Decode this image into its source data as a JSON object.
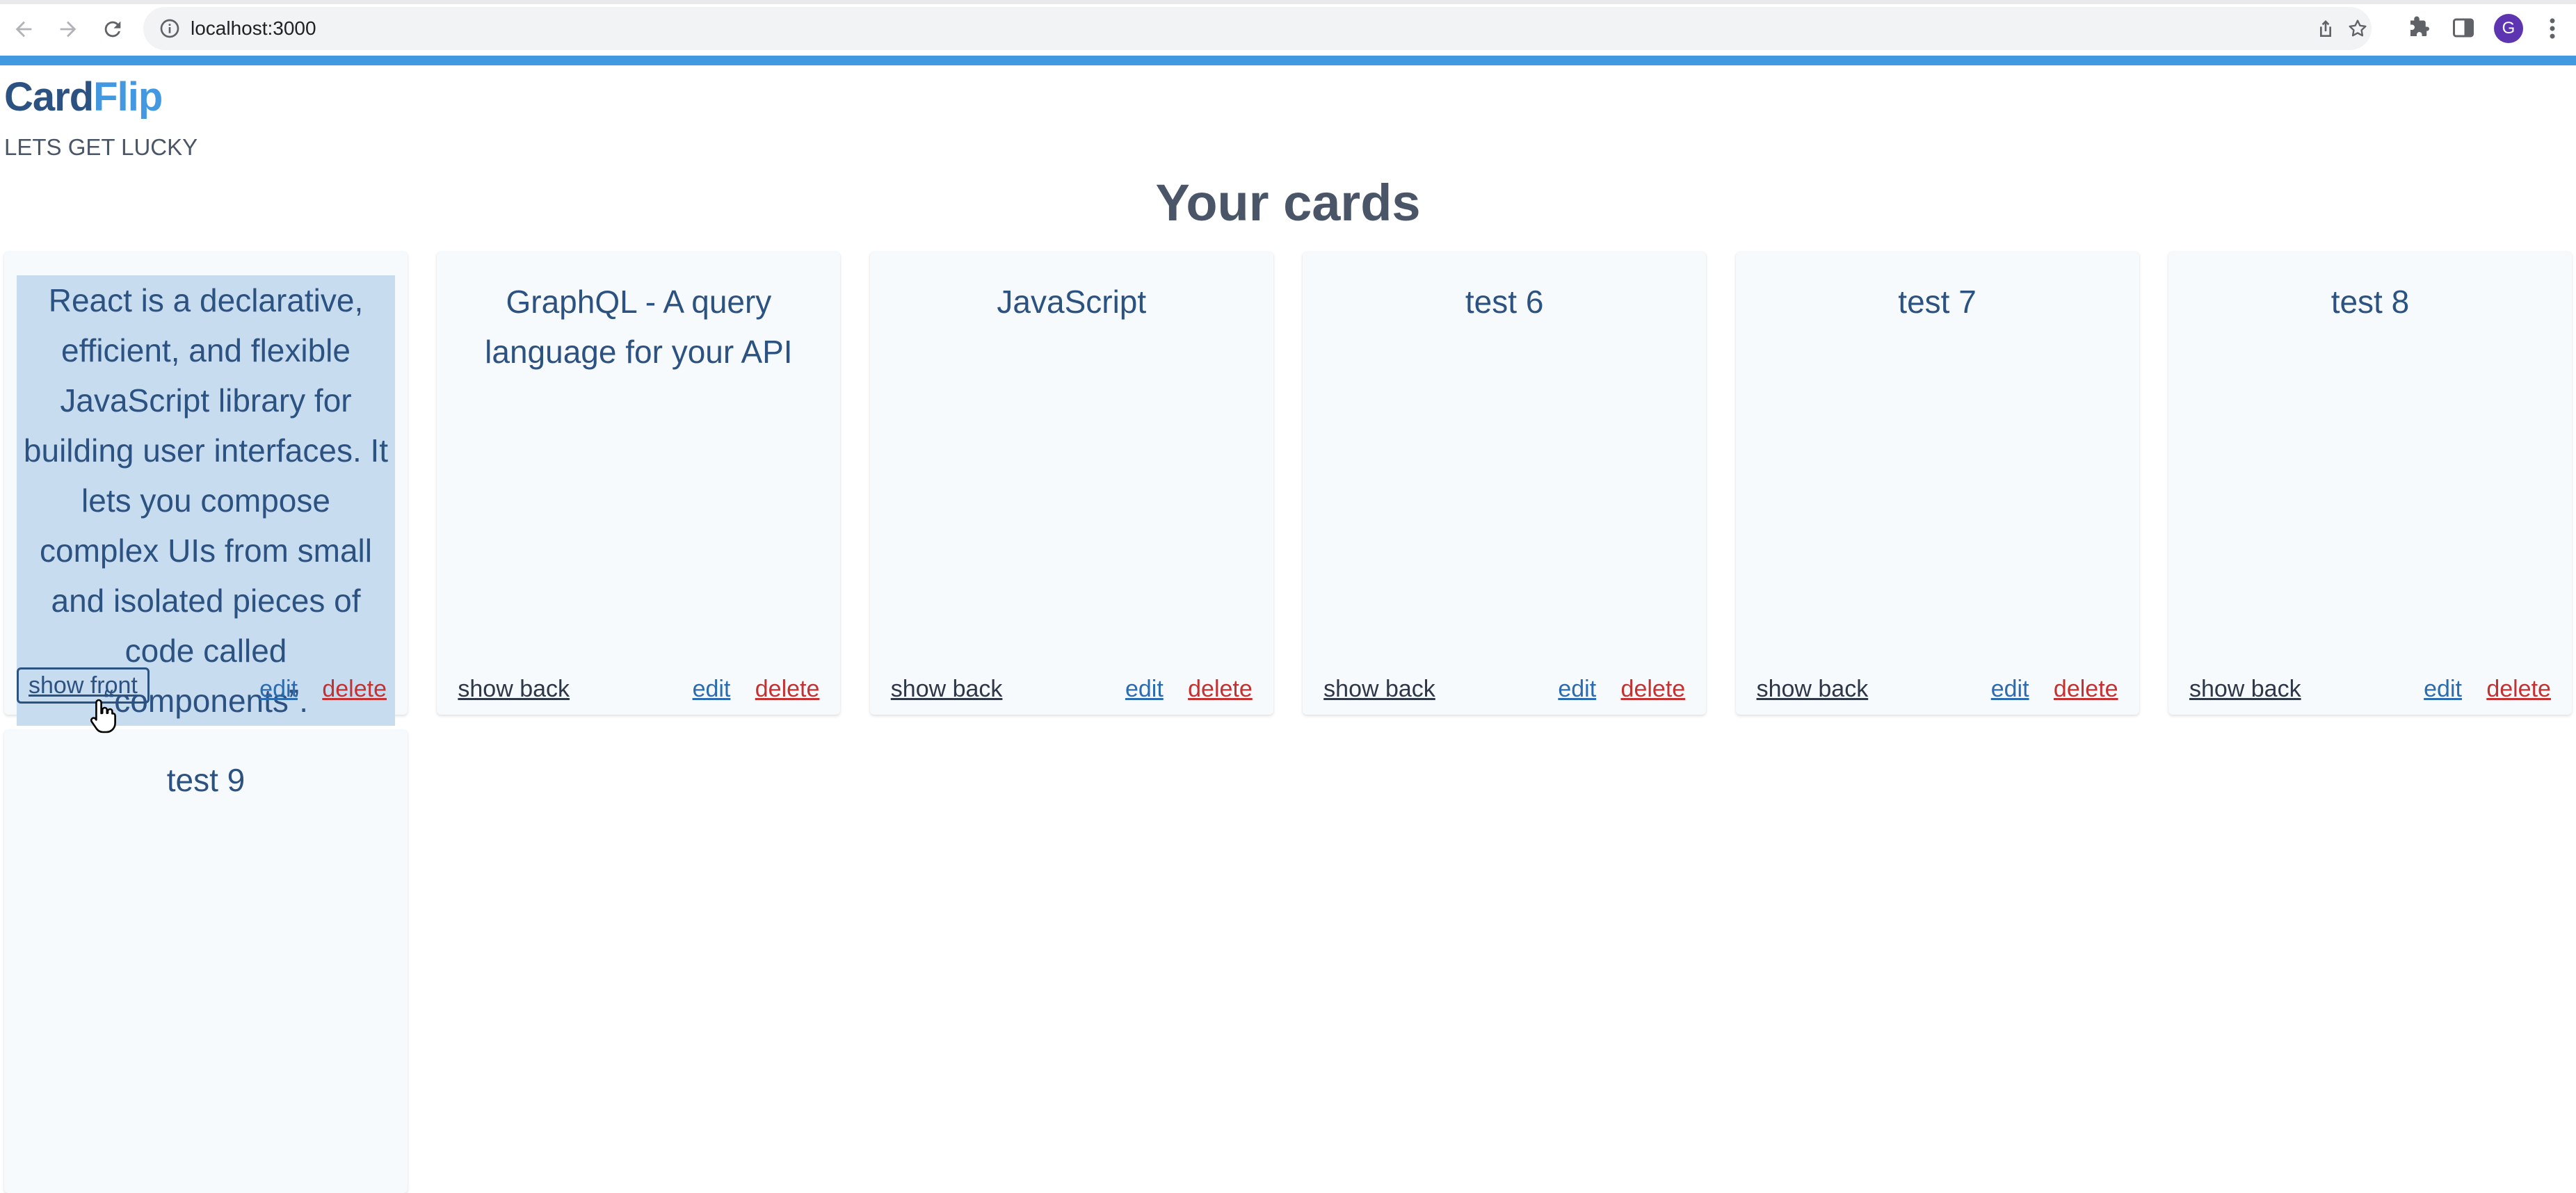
{
  "browser": {
    "url": "localhost:3000",
    "avatar_letter": "G"
  },
  "colors": {
    "accent": "#4299e1",
    "brand_dark": "#2c5282",
    "delete": "#c53030",
    "edit": "#2b6cb0",
    "flipped_bg": "#c8dcf0"
  },
  "header": {
    "brand_part1": "Card",
    "brand_part2": "Flip",
    "tagline": "LETS GET LUCKY"
  },
  "main": {
    "title": "Your cards",
    "cards": [
      {
        "text": "React is a declarative, efficient, and flexible JavaScript library for building user interfaces. It lets you compose complex UIs from small and isolated pieces of code called “components”.",
        "flip_label": "show front",
        "edit_label": "edit",
        "delete_label": "delete"
      },
      {
        "text": "GraphQL - A query language for your API",
        "flip_label": "show back",
        "edit_label": "edit",
        "delete_label": "delete"
      },
      {
        "text": "JavaScript",
        "flip_label": "show back",
        "edit_label": "edit",
        "delete_label": "delete"
      },
      {
        "text": "test 6",
        "flip_label": "show back",
        "edit_label": "edit",
        "delete_label": "delete"
      },
      {
        "text": "test 7",
        "flip_label": "show back",
        "edit_label": "edit",
        "delete_label": "delete"
      },
      {
        "text": "test 8",
        "flip_label": "show back",
        "edit_label": "edit",
        "delete_label": "delete"
      },
      {
        "text": "test 9"
      }
    ]
  }
}
